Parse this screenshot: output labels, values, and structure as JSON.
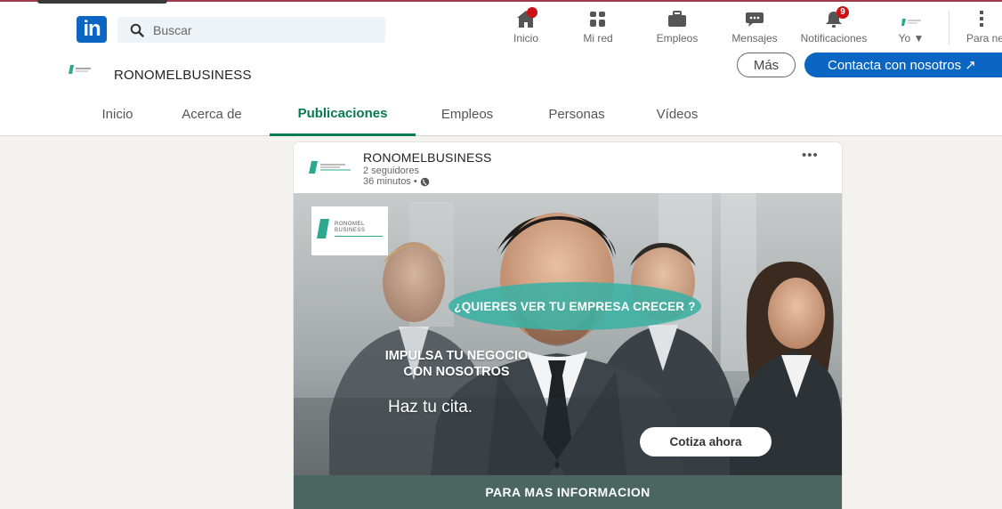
{
  "nav": {
    "search_placeholder": "Buscar",
    "items": [
      {
        "label": "Inicio",
        "icon": "home-icon",
        "badge": ""
      },
      {
        "label": "Mi red",
        "icon": "network-icon",
        "badge": ""
      },
      {
        "label": "Empleos",
        "icon": "briefcase-icon",
        "badge": ""
      },
      {
        "label": "Mensajes",
        "icon": "messaging-icon",
        "badge": ""
      },
      {
        "label": "Notificaciones",
        "icon": "bell-icon",
        "badge": "9"
      },
      {
        "label": "Yo",
        "icon": "profile-avatar",
        "badge": ""
      },
      {
        "label": "Para neg",
        "icon": "grid-icon",
        "badge": ""
      }
    ],
    "colors": {
      "brand": "#0a66c2",
      "badge": "#cc1016"
    }
  },
  "company": {
    "name": "RONOMELBUSINESS",
    "more_label": "Más",
    "contact_label": "Contacta con nosotros"
  },
  "tabs": [
    {
      "label": "Inicio",
      "active": false
    },
    {
      "label": "Acerca de",
      "active": false
    },
    {
      "label": "Publicaciones",
      "active": true
    },
    {
      "label": "Empleos",
      "active": false
    },
    {
      "label": "Personas",
      "active": false
    },
    {
      "label": "Vídeos",
      "active": false
    }
  ],
  "post": {
    "author": "RONOMELBUSINESS",
    "followers": "2 seguidores",
    "time": "36 minutos •",
    "menu": "•••",
    "image": {
      "logo_text_1": "RONOMEL",
      "logo_text_2": "BUSINESS",
      "question": "¿QUIERES VER TU EMPRESA CRECER ?",
      "headline_1": "IMPULSA TU NEGOCIO",
      "headline_2": "CON NOSOTROS",
      "cta_text": "Haz tu cita.",
      "cta_button": "Cotiza ahora",
      "info_banner": "PARA MAS INFORMACION"
    }
  },
  "accent": {
    "tab_active": "#067a52",
    "pill": "#3bb0a4",
    "banner": "#4a665e"
  }
}
